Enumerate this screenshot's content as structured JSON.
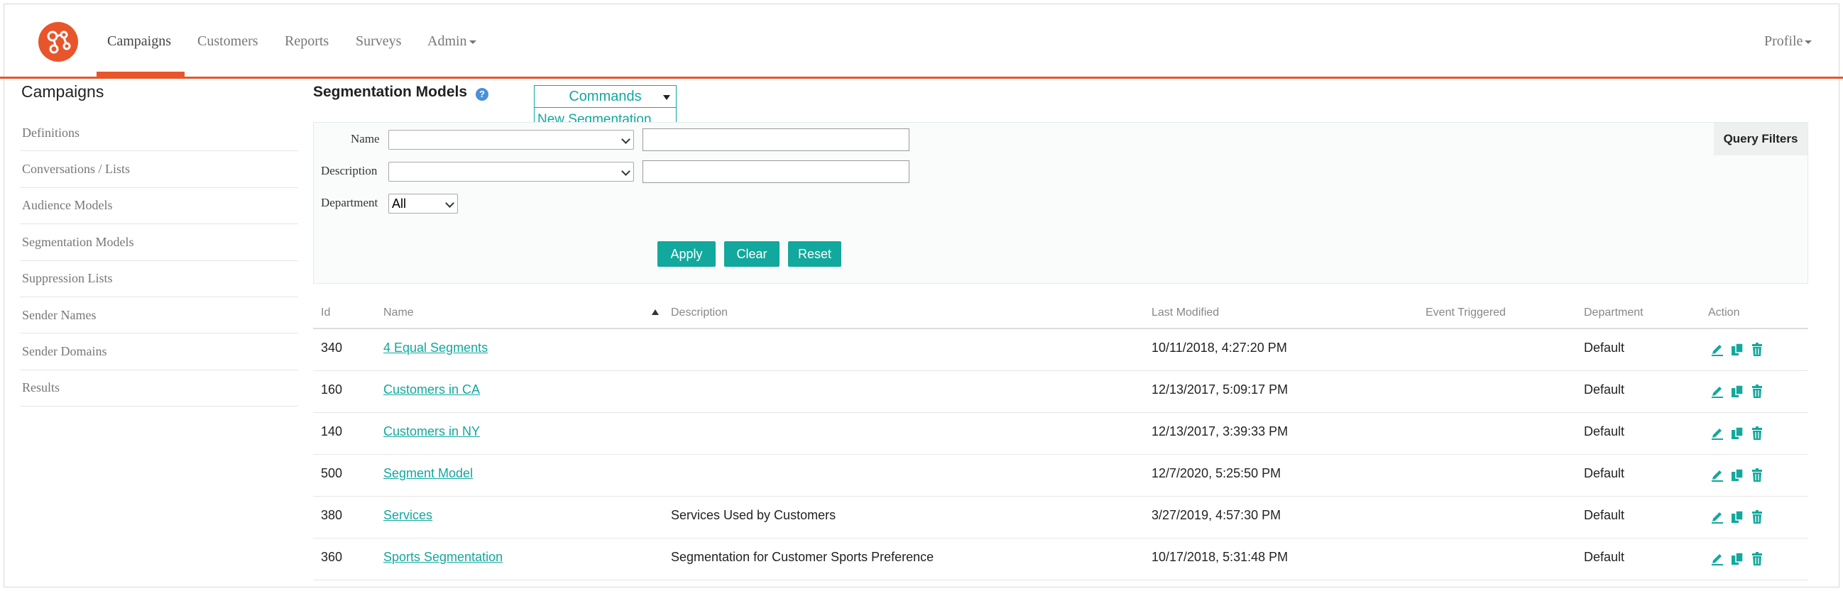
{
  "nav": {
    "items": [
      "Campaigns",
      "Customers",
      "Reports",
      "Surveys",
      "Admin"
    ],
    "profile": "Profile"
  },
  "sidebar": {
    "title": "Campaigns",
    "items": [
      "Definitions",
      "Conversations / Lists",
      "Audience Models",
      "Segmentation Models",
      "Suppression Lists",
      "Sender Names",
      "Sender Domains",
      "Results"
    ]
  },
  "main": {
    "title": "Segmentation Models",
    "commands_label": "Commands",
    "commands_menu": [
      "New Segmentation"
    ],
    "query_filters_label": "Query Filters"
  },
  "filters": {
    "name_label": "Name",
    "description_label": "Description",
    "department_label": "Department",
    "department_value": "All",
    "apply_label": "Apply",
    "clear_label": "Clear",
    "reset_label": "Reset"
  },
  "table": {
    "headers": [
      "Id",
      "Name",
      "Description",
      "Last Modified",
      "Event Triggered",
      "Department",
      "Action"
    ],
    "rows": [
      {
        "id": "340",
        "name": "4 Equal Segments",
        "description": "",
        "modified": "10/11/2018, 4:27:20 PM",
        "event": "",
        "department": "Default"
      },
      {
        "id": "160",
        "name": "Customers in CA",
        "description": "",
        "modified": "12/13/2017, 5:09:17 PM",
        "event": "",
        "department": "Default"
      },
      {
        "id": "140",
        "name": "Customers in NY",
        "description": "",
        "modified": "12/13/2017, 3:39:33 PM",
        "event": "",
        "department": "Default"
      },
      {
        "id": "500",
        "name": "Segment Model",
        "description": "",
        "modified": "12/7/2020, 5:25:50 PM",
        "event": "",
        "department": "Default"
      },
      {
        "id": "380",
        "name": "Services",
        "description": "Services Used by Customers",
        "modified": "3/27/2019, 4:57:30 PM",
        "event": "",
        "department": "Default"
      },
      {
        "id": "360",
        "name": "Sports Segmentation",
        "description": "Segmentation for Customer Sports Preference",
        "modified": "10/17/2018, 5:31:48 PM",
        "event": "",
        "department": "Default"
      }
    ]
  },
  "colors": {
    "accent": "#12a89d",
    "brand": "#e8552b"
  }
}
